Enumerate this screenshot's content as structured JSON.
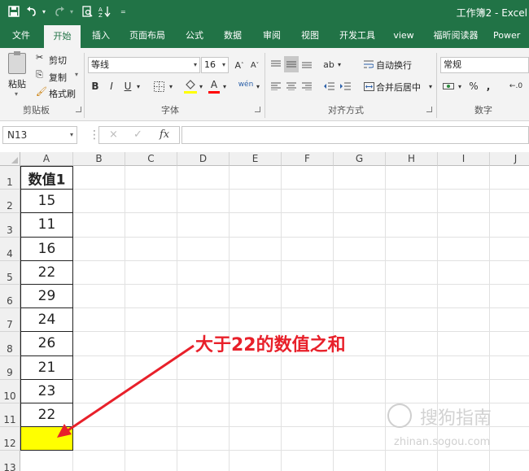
{
  "titlebar": {
    "title": "工作簿2 - Excel",
    "qat": {
      "save_icon": "save-icon",
      "undo_icon": "undo-icon",
      "redo_icon": "redo-icon",
      "print_preview_icon": "print-preview-icon",
      "sort_icon": "sort-icon"
    }
  },
  "tabs": [
    {
      "label": "文件"
    },
    {
      "label": "开始"
    },
    {
      "label": "插入"
    },
    {
      "label": "页面布局"
    },
    {
      "label": "公式"
    },
    {
      "label": "数据"
    },
    {
      "label": "审阅"
    },
    {
      "label": "视图"
    },
    {
      "label": "开发工具"
    },
    {
      "label": "view"
    },
    {
      "label": "福昕阅读器"
    },
    {
      "label": "Power"
    }
  ],
  "ribbon": {
    "clipboard": {
      "paste": "粘贴",
      "cut": "剪切",
      "copy": "复制",
      "format_painter": "格式刷",
      "group": "剪贴板"
    },
    "font": {
      "font_name": "等线",
      "font_size": "16",
      "bold": "B",
      "italic": "I",
      "underline": "U",
      "group": "字体",
      "phonetic": "wén",
      "increase_icon": "A˄",
      "decrease_icon": "A˅"
    },
    "alignment": {
      "wrap_text": "自动换行",
      "merge_center": "合并后居中",
      "group": "对齐方式"
    },
    "number": {
      "format": "常规",
      "percent": "%",
      "comma": ",",
      "group": "数字"
    },
    "colors": {
      "accent": "#217346",
      "highlight": "#ffff00",
      "font_color": "#ff0000"
    }
  },
  "formula_bar": {
    "name_box": "N13",
    "cancel": "×",
    "enter": "✓",
    "fx": "fx",
    "content": ""
  },
  "sheet": {
    "columns": [
      "A",
      "B",
      "C",
      "D",
      "E",
      "F",
      "G",
      "H",
      "I",
      "J"
    ],
    "rows": [
      "1",
      "2",
      "3",
      "4",
      "5",
      "6",
      "7",
      "8",
      "9",
      "10",
      "11",
      "12",
      "13"
    ],
    "column_a": [
      "数值1",
      "15",
      "11",
      "16",
      "22",
      "29",
      "24",
      "26",
      "21",
      "23",
      "22",
      ""
    ],
    "highlight_cell": "A12"
  },
  "annotation": {
    "text": "大于22的数值之和",
    "color": "#e8202a"
  },
  "watermark": {
    "text": "搜狗指南",
    "url": "zhinan.sogou.com"
  }
}
